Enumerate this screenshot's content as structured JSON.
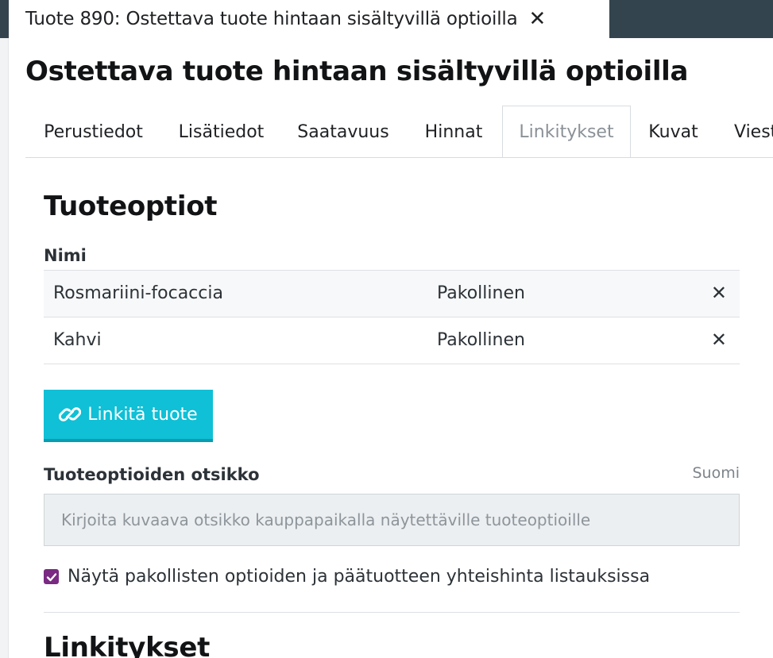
{
  "window_tab": {
    "title": "Tuote 890: Ostettava tuote hintaan sisältyvillä optioilla",
    "close_symbol": "✕"
  },
  "page": {
    "title": "Ostettava tuote hintaan sisältyvillä optioilla"
  },
  "tabs": [
    {
      "label": "Perustiedot",
      "active": false
    },
    {
      "label": "Lisätiedot",
      "active": false
    },
    {
      "label": "Saatavuus",
      "active": false
    },
    {
      "label": "Hinnat",
      "active": false
    },
    {
      "label": "Linkitykset",
      "active": true
    },
    {
      "label": "Kuvat",
      "active": false
    },
    {
      "label": "Viesti",
      "active": false
    }
  ],
  "product_options": {
    "title": "Tuoteoptiot",
    "column_name": "Nimi",
    "rows": [
      {
        "name": "Rosmariini-focaccia",
        "required": "Pakollinen"
      },
      {
        "name": "Kahvi",
        "required": "Pakollinen"
      }
    ],
    "remove_symbol": "✕",
    "link_button_label": "Linkitä tuote",
    "link_icon": "link-icon"
  },
  "heading_field": {
    "label": "Tuoteoptioiden otsikko",
    "language": "Suomi",
    "value": "",
    "placeholder": "Kirjoita kuvaava otsikko kauppapaikalla näytettäville tuoteoptioille"
  },
  "show_total_price": {
    "checked": true,
    "label": "Näytä pakollisten optioiden ja päätuotteen yhteishinta listauksissa"
  },
  "links_section": {
    "title": "Linkitykset"
  },
  "colors": {
    "topbar": "#34444f",
    "accent_button": "#0fc0d6",
    "checkbox": "#7a2a82"
  }
}
